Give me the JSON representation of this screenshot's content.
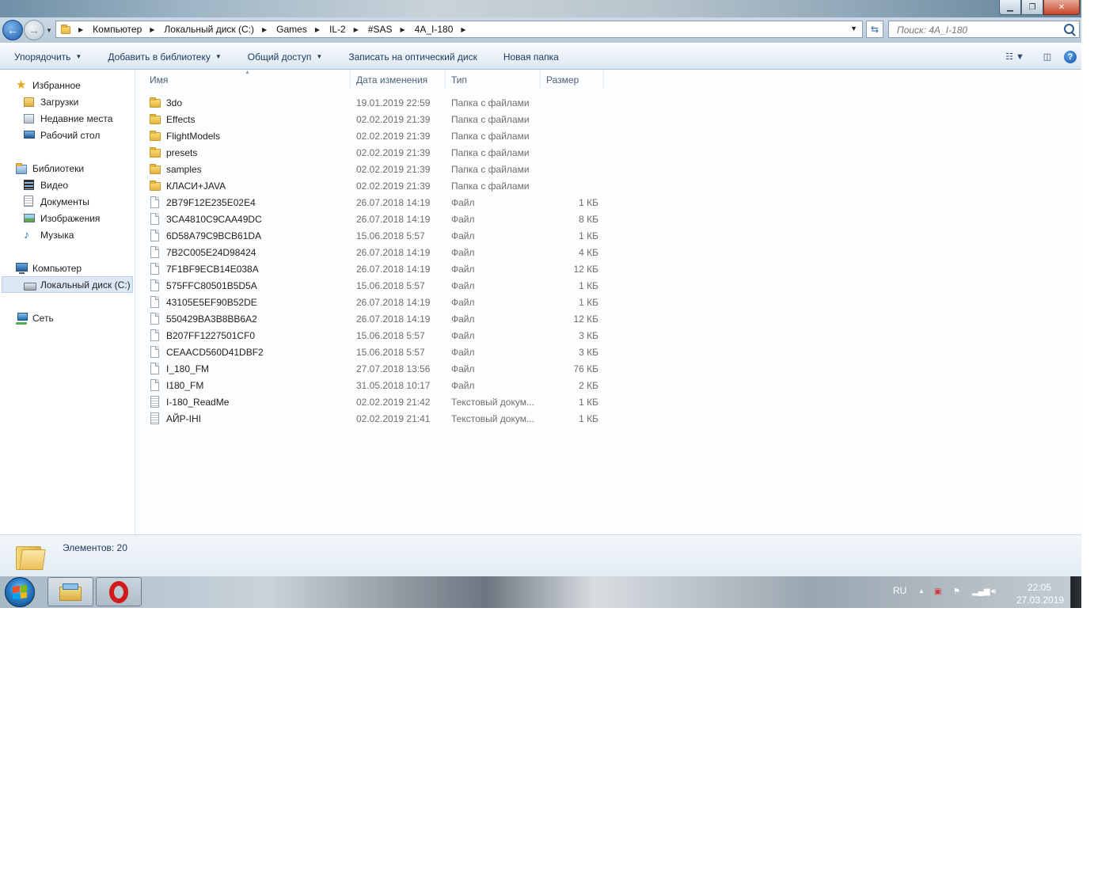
{
  "window": {
    "minimize_icon": "minimize-icon",
    "maximize_icon": "maximize-icon",
    "close_icon": "close-icon"
  },
  "address": {
    "breadcrumbs": [
      "Компьютер",
      "Локальный диск (C:)",
      "Games",
      "IL-2",
      "#SAS",
      "4A_I-180"
    ],
    "search_placeholder": "Поиск: 4A_I-180"
  },
  "toolbar": {
    "organize": "Упорядочить",
    "add_library": "Добавить в библиотеку",
    "share": "Общий доступ",
    "burn": "Записать на оптический диск",
    "new_folder": "Новая папка"
  },
  "nav": {
    "favorites": {
      "label": "Избранное",
      "items": [
        "Загрузки",
        "Недавние места",
        "Рабочий стол"
      ]
    },
    "libraries": {
      "label": "Библиотеки",
      "items": [
        "Видео",
        "Документы",
        "Изображения",
        "Музыка"
      ]
    },
    "computer": {
      "label": "Компьютер",
      "items": [
        "Локальный диск (C:)"
      ],
      "selected": "Локальный диск (C:)"
    },
    "network": {
      "label": "Сеть"
    }
  },
  "columns": {
    "name": "Имя",
    "date": "Дата изменения",
    "type": "Тип",
    "size": "Размер"
  },
  "files": [
    {
      "name": "3do",
      "date": "19.01.2019 22:59",
      "type": "Папка с файлами",
      "size": "",
      "icon": "folder"
    },
    {
      "name": "Effects",
      "date": "02.02.2019 21:39",
      "type": "Папка с файлами",
      "size": "",
      "icon": "folder"
    },
    {
      "name": "FlightModels",
      "date": "02.02.2019 21:39",
      "type": "Папка с файлами",
      "size": "",
      "icon": "folder"
    },
    {
      "name": "presets",
      "date": "02.02.2019 21:39",
      "type": "Папка с файлами",
      "size": "",
      "icon": "folder"
    },
    {
      "name": "samples",
      "date": "02.02.2019 21:39",
      "type": "Папка с файлами",
      "size": "",
      "icon": "folder"
    },
    {
      "name": "КЛАСИ+JAVA",
      "date": "02.02.2019 21:39",
      "type": "Папка с файлами",
      "size": "",
      "icon": "folder"
    },
    {
      "name": "2B79F12E235E02E4",
      "date": "26.07.2018 14:19",
      "type": "Файл",
      "size": "1 КБ",
      "icon": "file"
    },
    {
      "name": "3CA4810C9CAA49DC",
      "date": "26.07.2018 14:19",
      "type": "Файл",
      "size": "8 КБ",
      "icon": "file"
    },
    {
      "name": "6D58A79C9BCB61DA",
      "date": "15.06.2018 5:57",
      "type": "Файл",
      "size": "1 КБ",
      "icon": "file"
    },
    {
      "name": "7B2C005E24D98424",
      "date": "26.07.2018 14:19",
      "type": "Файл",
      "size": "4 КБ",
      "icon": "file"
    },
    {
      "name": "7F1BF9ECB14E038A",
      "date": "26.07.2018 14:19",
      "type": "Файл",
      "size": "12 КБ",
      "icon": "file"
    },
    {
      "name": "575FFC80501B5D5A",
      "date": "15.06.2018 5:57",
      "type": "Файл",
      "size": "1 КБ",
      "icon": "file"
    },
    {
      "name": "43105E5EF90B52DE",
      "date": "26.07.2018 14:19",
      "type": "Файл",
      "size": "1 КБ",
      "icon": "file"
    },
    {
      "name": "550429BA3B8BB6A2",
      "date": "26.07.2018 14:19",
      "type": "Файл",
      "size": "12 КБ",
      "icon": "file"
    },
    {
      "name": "B207FF1227501CF0",
      "date": "15.06.2018 5:57",
      "type": "Файл",
      "size": "3 КБ",
      "icon": "file"
    },
    {
      "name": "CEAACD560D41DBF2",
      "date": "15.06.2018 5:57",
      "type": "Файл",
      "size": "3 КБ",
      "icon": "file"
    },
    {
      "name": "I_180_FM",
      "date": "27.07.2018 13:56",
      "type": "Файл",
      "size": "76 КБ",
      "icon": "file"
    },
    {
      "name": "I180_FM",
      "date": "31.05.2018 10:17",
      "type": "Файл",
      "size": "2 КБ",
      "icon": "file"
    },
    {
      "name": "I-180_ReadMe",
      "date": "02.02.2019 21:42",
      "type": "Текстовый докум...",
      "size": "1 КБ",
      "icon": "text"
    },
    {
      "name": "АЙР-ІНІ",
      "date": "02.02.2019 21:41",
      "type": "Текстовый докум...",
      "size": "1 КБ",
      "icon": "text"
    }
  ],
  "details": {
    "count": "Элементов: 20"
  },
  "taskbar": {
    "language": "RU",
    "time": "22:05",
    "date": "27.03.2019"
  }
}
